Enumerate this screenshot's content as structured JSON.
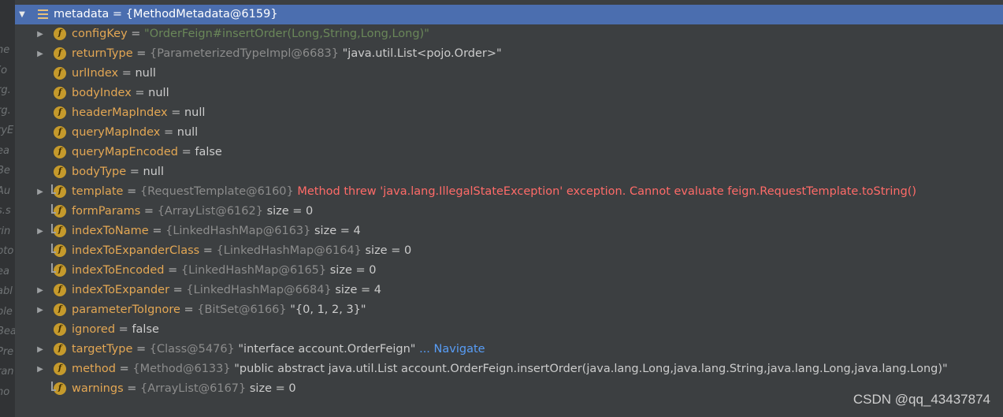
{
  "left_strip_fragments": [
    "ne",
    "(o",
    "rg.",
    "rg.",
    "ryE",
    "ea",
    "Be",
    "Au",
    "s.s",
    "rin",
    "pto",
    "ea",
    "abl",
    "ble",
    "Bea",
    "Pre",
    "ran",
    "no"
  ],
  "root": {
    "name": "metadata",
    "ref": "{MethodMetadata@6159}"
  },
  "fields": [
    {
      "name": "configKey",
      "expandable": true,
      "ref": "",
      "value": "\"OrderFeign#insertOrder(Long,String,Long,Long)\"",
      "value_type": "str",
      "extra": "",
      "navigate": "",
      "error": "",
      "final_only": false
    },
    {
      "name": "returnType",
      "expandable": true,
      "ref": "{ParameterizedTypeImpl@6683}",
      "value": "\"java.util.List<pojo.Order>\"",
      "value_type": "val",
      "extra": "",
      "navigate": "",
      "error": "",
      "final_only": false
    },
    {
      "name": "urlIndex",
      "expandable": false,
      "ref": "",
      "value": "null",
      "value_type": "val",
      "extra": "",
      "navigate": "",
      "error": "",
      "final_only": false
    },
    {
      "name": "bodyIndex",
      "expandable": false,
      "ref": "",
      "value": "null",
      "value_type": "val",
      "extra": "",
      "navigate": "",
      "error": "",
      "final_only": false
    },
    {
      "name": "headerMapIndex",
      "expandable": false,
      "ref": "",
      "value": "null",
      "value_type": "val",
      "extra": "",
      "navigate": "",
      "error": "",
      "final_only": false
    },
    {
      "name": "queryMapIndex",
      "expandable": false,
      "ref": "",
      "value": "null",
      "value_type": "val",
      "extra": "",
      "navigate": "",
      "error": "",
      "final_only": false
    },
    {
      "name": "queryMapEncoded",
      "expandable": false,
      "ref": "",
      "value": "false",
      "value_type": "val",
      "extra": "",
      "navigate": "",
      "error": "",
      "final_only": false
    },
    {
      "name": "bodyType",
      "expandable": false,
      "ref": "",
      "value": "null",
      "value_type": "val",
      "extra": "",
      "navigate": "",
      "error": "",
      "final_only": false
    },
    {
      "name": "template",
      "expandable": true,
      "ref": "{RequestTemplate@6160}",
      "value": "",
      "value_type": "val",
      "extra": "",
      "navigate": "",
      "error": "Method threw 'java.lang.IllegalStateException' exception. Cannot evaluate feign.RequestTemplate.toString()",
      "final_only": true
    },
    {
      "name": "formParams",
      "expandable": false,
      "ref": "{ArrayList@6162}",
      "value": "",
      "value_type": "val",
      "extra": "size = 0",
      "navigate": "",
      "error": "",
      "final_only": true
    },
    {
      "name": "indexToName",
      "expandable": true,
      "ref": "{LinkedHashMap@6163}",
      "value": "",
      "value_type": "val",
      "extra": "size = 4",
      "navigate": "",
      "error": "",
      "final_only": true
    },
    {
      "name": "indexToExpanderClass",
      "expandable": false,
      "ref": "{LinkedHashMap@6164}",
      "value": "",
      "value_type": "val",
      "extra": "size = 0",
      "navigate": "",
      "error": "",
      "final_only": true
    },
    {
      "name": "indexToEncoded",
      "expandable": false,
      "ref": "{LinkedHashMap@6165}",
      "value": "",
      "value_type": "val",
      "extra": "size = 0",
      "navigate": "",
      "error": "",
      "final_only": true
    },
    {
      "name": "indexToExpander",
      "expandable": true,
      "ref": "{LinkedHashMap@6684}",
      "value": "",
      "value_type": "val",
      "extra": "size = 4",
      "navigate": "",
      "error": "",
      "final_only": false
    },
    {
      "name": "parameterToIgnore",
      "expandable": true,
      "ref": "{BitSet@6166}",
      "value": "\"{0, 1, 2, 3}\"",
      "value_type": "val",
      "extra": "",
      "navigate": "",
      "error": "",
      "final_only": false
    },
    {
      "name": "ignored",
      "expandable": false,
      "ref": "",
      "value": "false",
      "value_type": "val",
      "extra": "",
      "navigate": "",
      "error": "",
      "final_only": false
    },
    {
      "name": "targetType",
      "expandable": true,
      "ref": "{Class@5476}",
      "value": "\"interface account.OrderFeign\"",
      "value_type": "val",
      "extra": "",
      "navigate": "... Navigate",
      "error": "",
      "final_only": false
    },
    {
      "name": "method",
      "expandable": true,
      "ref": "{Method@6133}",
      "value": "\"public abstract java.util.List account.OrderFeign.insertOrder(java.lang.Long,java.lang.String,java.lang.Long,java.lang.Long)\"",
      "value_type": "val",
      "extra": "",
      "navigate": "",
      "error": "",
      "final_only": false
    },
    {
      "name": "warnings",
      "expandable": false,
      "ref": "{ArrayList@6167}",
      "value": "",
      "value_type": "val",
      "extra": "size = 0",
      "navigate": "",
      "error": "",
      "final_only": true
    }
  ],
  "watermark": "CSDN @qq_43437874"
}
